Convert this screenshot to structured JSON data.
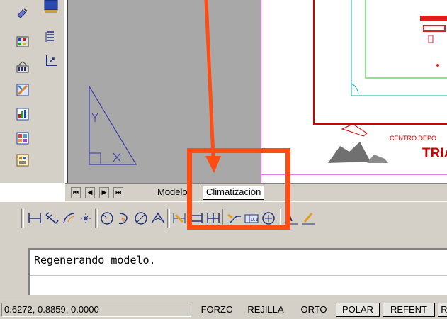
{
  "tabs": {
    "model_label": "Modelo",
    "layout_label": "Climatización"
  },
  "command_line": {
    "history_text": "Regenerando modelo.",
    "input_value": ""
  },
  "status_bar": {
    "coordinates": "0.6272, 0.8859, 0.0000",
    "buttons": [
      {
        "label": "FORZC",
        "active": false
      },
      {
        "label": "REJILLA",
        "active": false
      },
      {
        "label": "ORTO",
        "active": false
      },
      {
        "label": "POLAR",
        "active": true
      },
      {
        "label": "REFENT",
        "active": true
      },
      {
        "label": "R",
        "active": true
      }
    ]
  },
  "drawing": {
    "title_block_text": "CENTRO DEPO",
    "title_block_big": "TRIA"
  },
  "annotation": {
    "highlight_color": "#ff4d14",
    "arrow_color": "#ff4d14"
  },
  "icons": {
    "left_toolbar": [
      "paint-icon",
      "layer-properties-icon",
      "match-properties-icon",
      "layer-states-icon",
      "color-icon",
      "linetype-icon",
      "lineweight-icon",
      "plot-style-icon",
      "properties-icon",
      "design-center-icon",
      "tool-palette-icon"
    ],
    "dimension_toolbar": [
      "linear-dimension-icon",
      "aligned-dimension-icon",
      "arc-length-icon",
      "ordinate-icon",
      "radius-icon",
      "jogged-icon",
      "diameter-icon",
      "angular-icon",
      "quick-dimension-icon",
      "baseline-icon",
      "continue-icon",
      "quick-leader-icon",
      "tolerance-icon",
      "center-mark-icon",
      "dimension-edit-icon",
      "dimension-text-edit-icon"
    ]
  }
}
